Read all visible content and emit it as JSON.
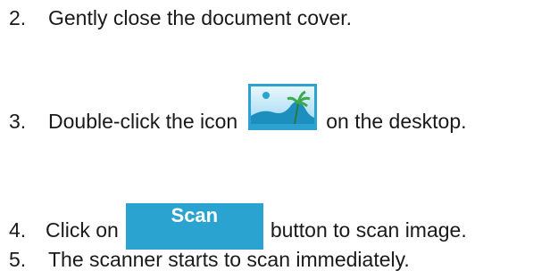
{
  "steps": [
    {
      "number": "2.",
      "text": "Gently close the document cover."
    },
    {
      "number": "3.",
      "text_before": "Double-click the icon",
      "text_after": "on the desktop.",
      "icon": "image-app-icon"
    },
    {
      "number": "4.",
      "text_before": "Click on",
      "text_after": "button to scan image.",
      "button_label": "Scan",
      "button_color": "#2ba3d1"
    },
    {
      "number": "5.",
      "text": "The scanner starts to scan immediately."
    }
  ]
}
